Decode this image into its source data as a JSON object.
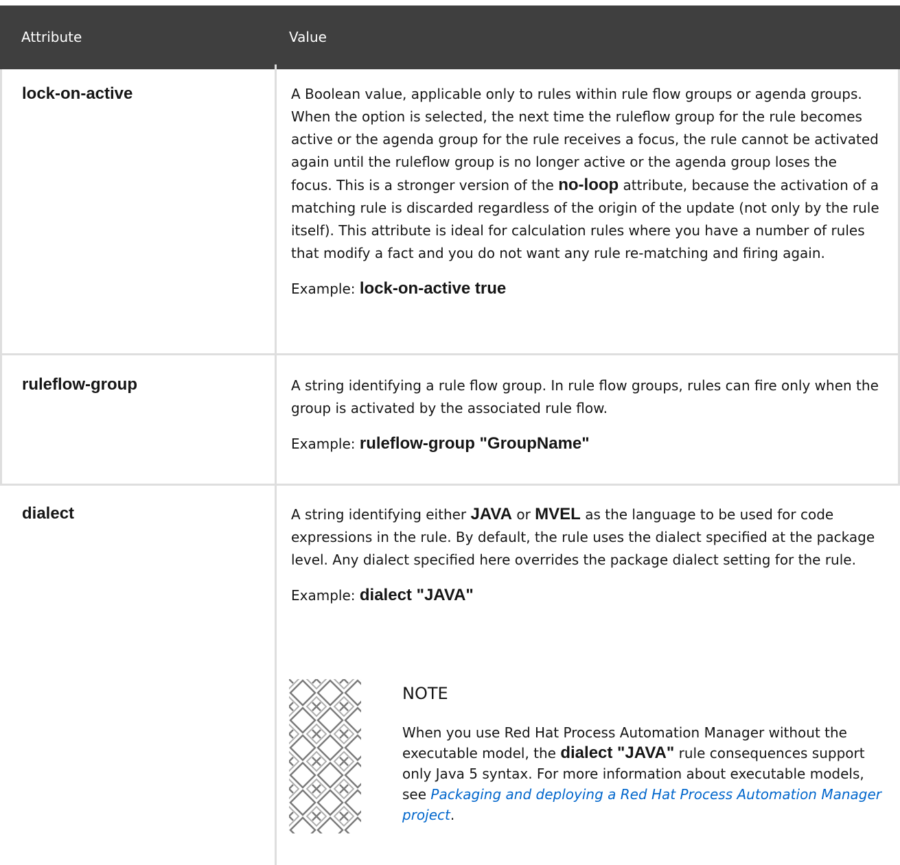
{
  "header": {
    "attribute": "Attribute",
    "value": "Value"
  },
  "rows": [
    {
      "name": "lock-on-active",
      "description": {
        "part1": "A Boolean value, applicable only to rules within rule flow groups or agenda groups. When the option is selected, the next time the ruleflow group for the rule becomes active or the agenda group for the rule receives a focus, the rule cannot be activated again until the ruleflow group is no longer active or the agenda group loses the focus. This is a stronger version of the ",
        "bold1": "no-loop",
        "part2": " attribute, because the activation of a matching rule is discarded regardless of the origin of the update (not only by the rule itself). This attribute is ideal for calculation rules where you have a number of rules that modify a fact and you do not want any rule re-matching and firing again."
      },
      "example_label": "Example: ",
      "example_code": "lock-on-active true"
    },
    {
      "name": "ruleflow-group",
      "description": {
        "part1": "A string identifying a rule flow group. In rule flow groups, rules can fire only when the group is activated by the associated rule flow."
      },
      "example_label": "Example: ",
      "example_code": "ruleflow-group \"GroupName\""
    },
    {
      "name": "dialect",
      "description": {
        "part1": "A string identifying either ",
        "bold1": "JAVA",
        "part2": " or ",
        "bold2": "MVEL",
        "part3": " as the language to be used for code expressions in the rule. By default, the rule uses the dialect specified at the package level. Any dialect specified here overrides the package dialect setting for the rule."
      },
      "example_label": "Example: ",
      "example_code": "dialect \"JAVA\"",
      "note": {
        "title": "NOTE",
        "part1": "When you use Red Hat Process Automation Manager without the executable model, the ",
        "bold1": "dialect \"JAVA\"",
        "part2": " rule consequences support only Java 5 syntax. For more information about executable models, see ",
        "link": "Packaging and deploying a Red Hat Process Automation Manager project",
        "part3": "."
      }
    }
  ]
}
